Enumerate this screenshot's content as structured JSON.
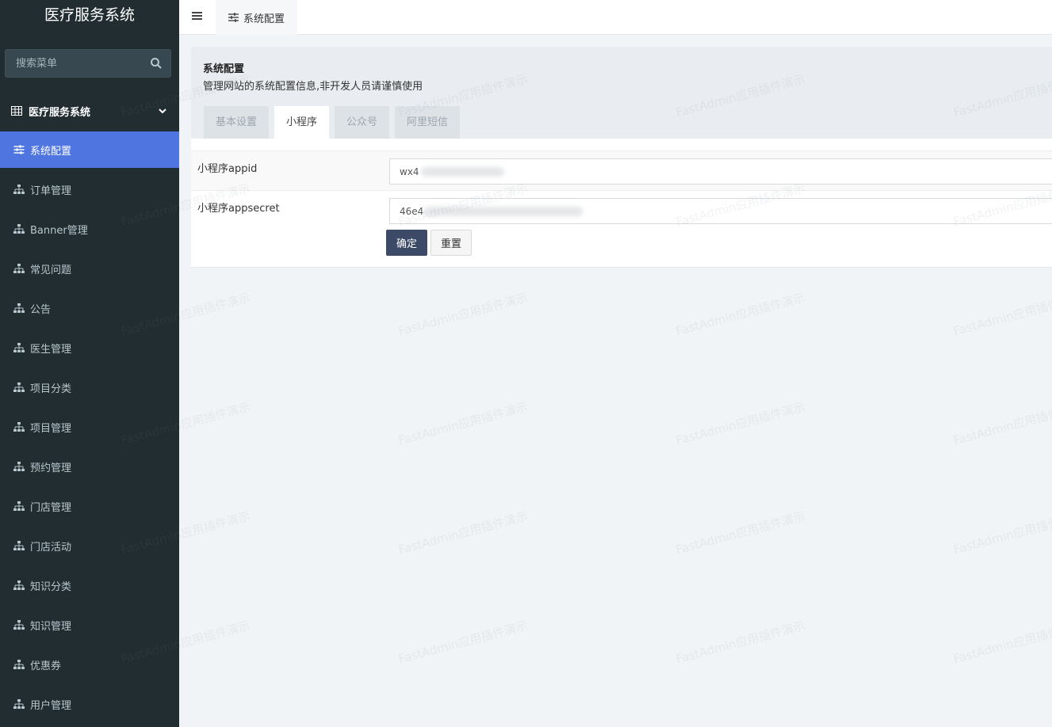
{
  "sidebar": {
    "brand": "医疗服务系统",
    "search_placeholder": "搜索菜单",
    "tree_header": "医疗服务系统",
    "items": [
      {
        "label": "系统配置",
        "active": true
      },
      {
        "label": "订单管理"
      },
      {
        "label": "Banner管理"
      },
      {
        "label": "常见问题"
      },
      {
        "label": "公告"
      },
      {
        "label": "医生管理"
      },
      {
        "label": "项目分类"
      },
      {
        "label": "项目管理"
      },
      {
        "label": "预约管理"
      },
      {
        "label": "门店管理"
      },
      {
        "label": "门店活动"
      },
      {
        "label": "知识分类"
      },
      {
        "label": "知识管理"
      },
      {
        "label": "优惠券"
      },
      {
        "label": "用户管理"
      }
    ]
  },
  "topbar": {
    "active_tab": "系统配置"
  },
  "panel": {
    "title": "系统配置",
    "description": "管理网站的系统配置信息,非开发人员请谨慎使用",
    "tabs": [
      "基本设置",
      "小程序",
      "公众号",
      "阿里短信"
    ],
    "active_tab_index": 1
  },
  "form": {
    "appid_label": "小程序appid",
    "appid_value": "wx4",
    "appsecret_label": "小程序appsecret",
    "appsecret_value": "46e4",
    "confirm_label": "确定",
    "reset_label": "重置"
  },
  "watermark": "FastAdmin应用插件演示",
  "colors": {
    "sidebar_bg": "#222d32",
    "active_item": "#4f76e0",
    "confirm_btn": "#3c4a68"
  }
}
